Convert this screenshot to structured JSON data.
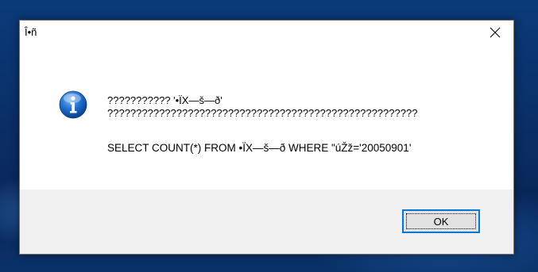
{
  "dialog": {
    "title": "Î•ñ",
    "close_glyph": "✕",
    "icon": "info-icon",
    "message_line1": "??????????? '•ÏX—š—ð'",
    "message_line2": "??????????????????????????????????????????????????????",
    "message_line3": "SELECT COUNT(*) FROM •ÏX—š—ð WHERE \"úŽž='20050901'",
    "ok_label": "OK"
  },
  "colors": {
    "accent": "#0078d7",
    "footer_bg": "#f0f0f0",
    "info_icon_blue": "#1565c0"
  }
}
